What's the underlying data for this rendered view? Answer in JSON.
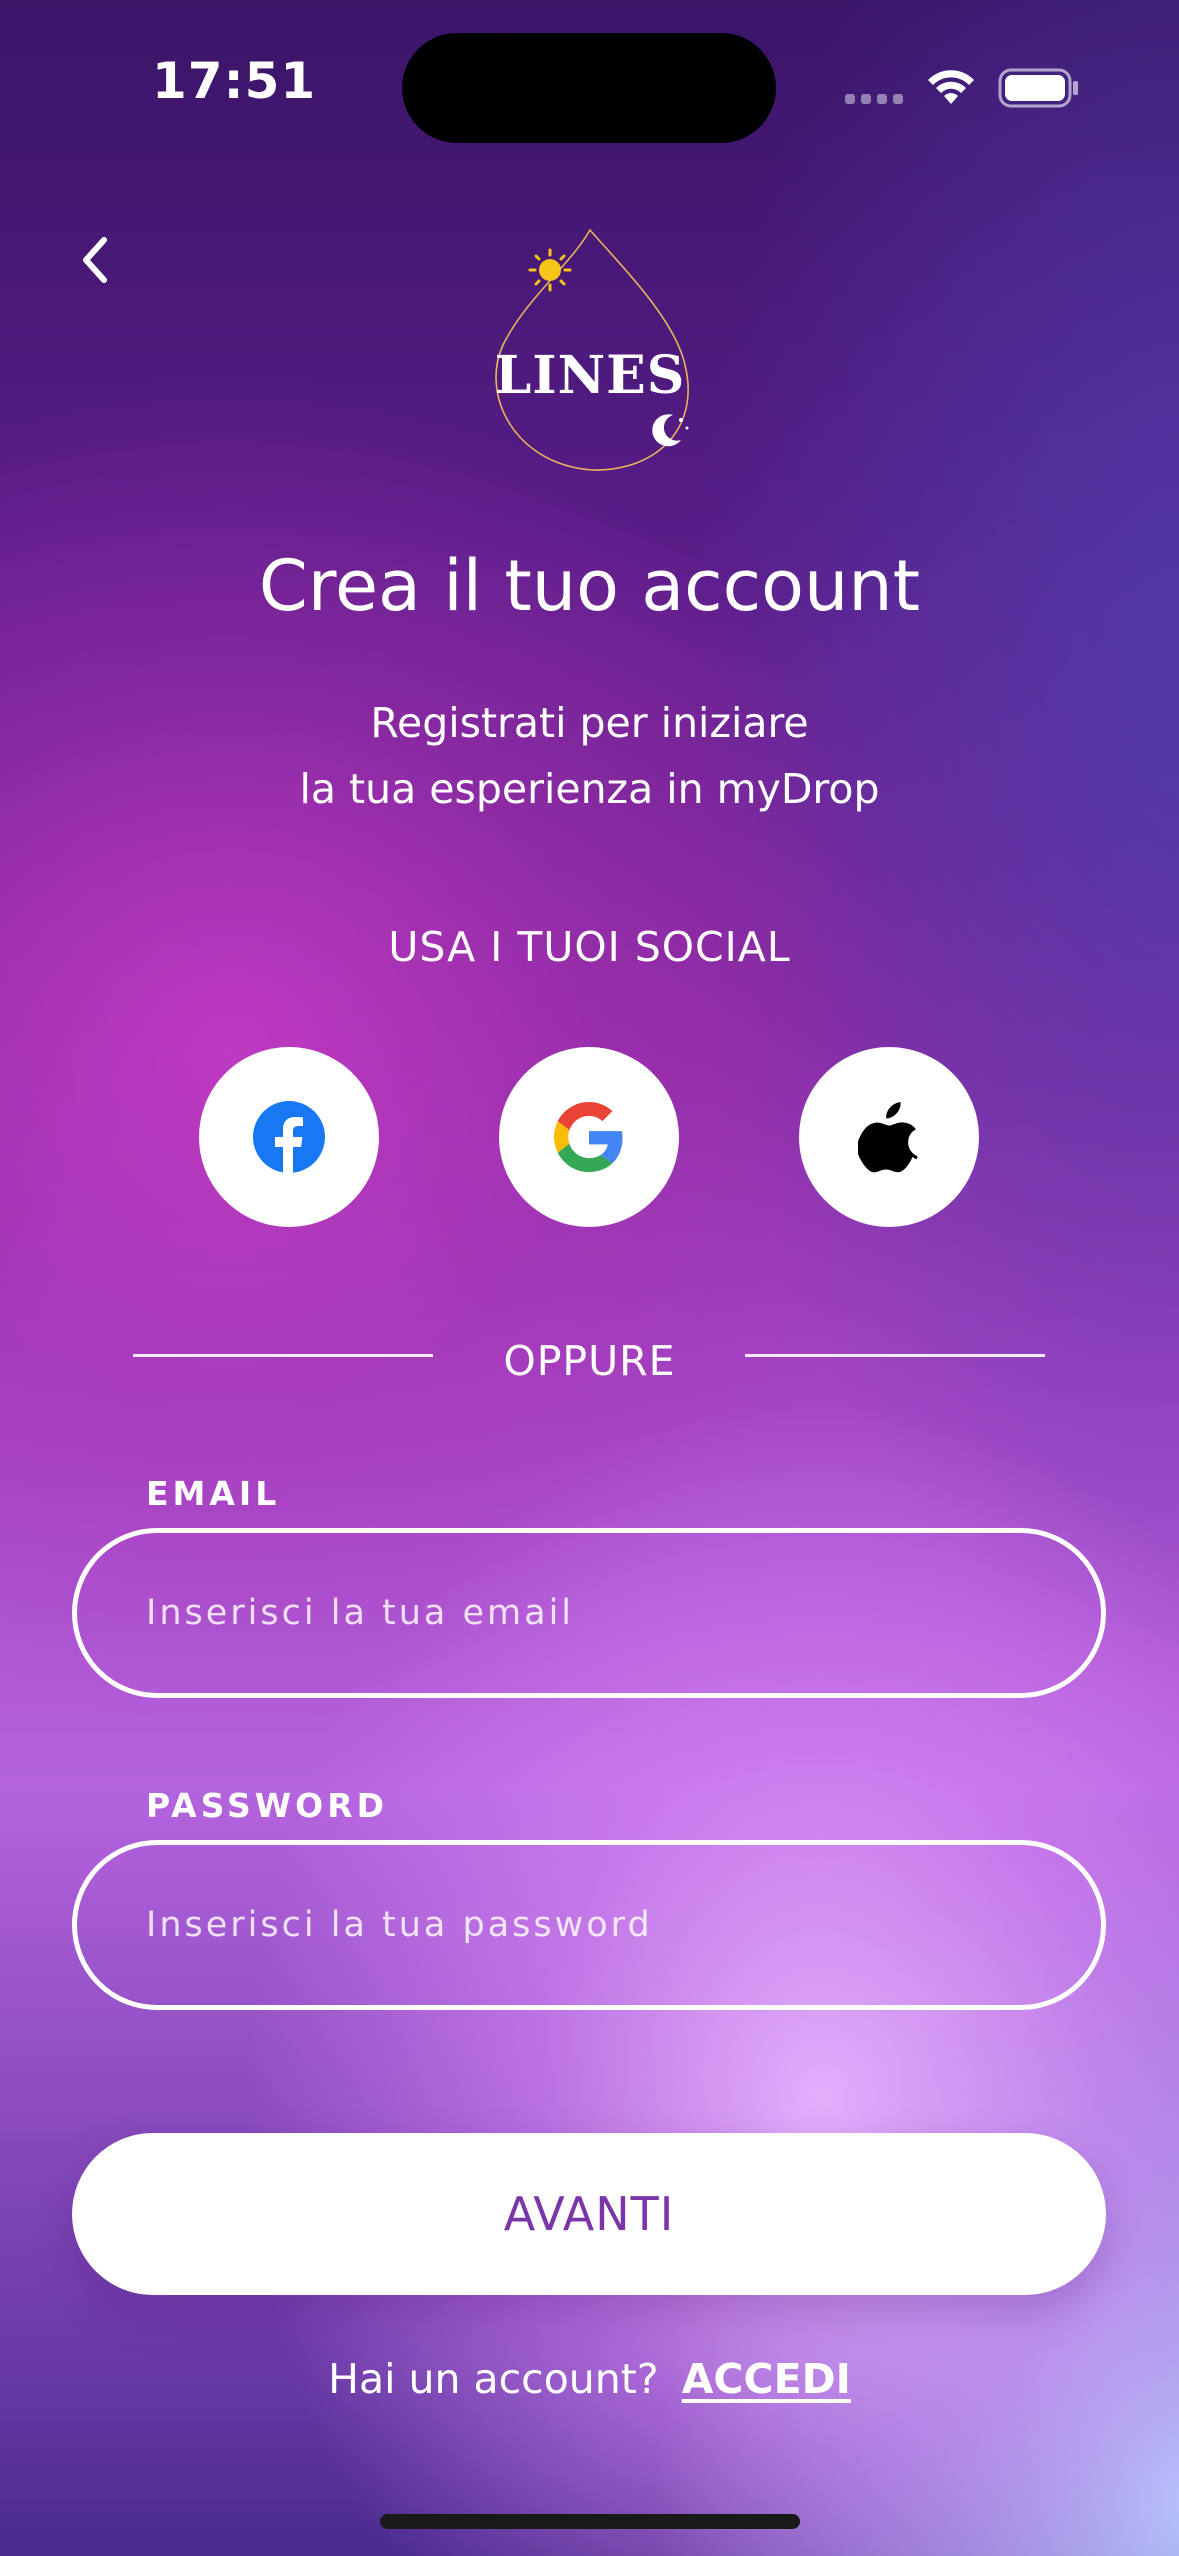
{
  "status_bar": {
    "time": "17:51",
    "icons": [
      "cellular-signal-icon",
      "wifi-icon",
      "battery-icon"
    ]
  },
  "header": {
    "back_icon": "chevron-left-icon",
    "logo_text": "LINES"
  },
  "title": "Crea il tuo account",
  "subtitle": {
    "line1": "Registrati per iniziare",
    "line2": "la tua esperienza in myDrop"
  },
  "social": {
    "label": "USA I TUOI SOCIAL",
    "buttons": [
      {
        "icon": "facebook-icon",
        "color": "#1877F2"
      },
      {
        "icon": "google-icon"
      },
      {
        "icon": "apple-icon",
        "color": "#000000"
      }
    ]
  },
  "divider": {
    "text": "OPPURE"
  },
  "form": {
    "email": {
      "label": "EMAIL",
      "placeholder": "Inserisci la tua email",
      "value": ""
    },
    "password": {
      "label": "PASSWORD",
      "placeholder": "Inserisci la tua password",
      "value": ""
    }
  },
  "primary_button": {
    "label": "AVANTI",
    "text_color": "#7A35A8"
  },
  "footer": {
    "prompt": "Hai un account?",
    "link": "ACCEDI"
  },
  "colors": {
    "background_top": "#3A1568",
    "background_mid": "#A546C6",
    "background_light": "#E7B4FF",
    "accent_gold": "#F5C518"
  }
}
